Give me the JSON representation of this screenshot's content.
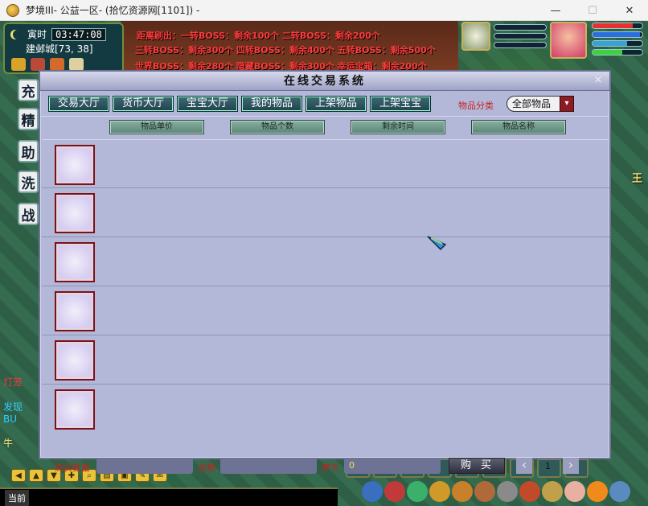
{
  "window": {
    "title": "梦境III- 公益一区- (拾忆资源网[1101]) -",
    "minimize": "—",
    "maximize": "☐",
    "close": "✕"
  },
  "hud": {
    "clock_label": "寅时",
    "time": "03:47:08",
    "location": "建邺城[73, 38]",
    "boss_lines": [
      "距离刷出：一转BOSS：剩余100个  二转BOSS：剩余200个",
      "三转BOSS：剩余300个  四转BOSS：剩余400个  五转BOSS：剩余500个",
      "世界BOSS：剩余280个  隐藏BOSS：剩余300个  幸运宝箱：剩余200个"
    ],
    "side_buttons": [
      "充",
      "精",
      "助",
      "洗",
      "战"
    ],
    "chat_left": [
      "灯笼",
      "发现BU",
      "牛"
    ],
    "chat_channel": "当前",
    "right_text": "王"
  },
  "bars": {
    "player_hp": 0.8,
    "player_mp": 0.95,
    "player_sp": 0.7,
    "player_exp": 0.6,
    "colors": {
      "hp": "#e83030",
      "mp": "#2a6ee0",
      "sp": "#3aa0d8",
      "exp": "#3fd040"
    }
  },
  "dialog": {
    "title": "在线交易系统",
    "close": "×",
    "tabs": [
      "交易大厅",
      "货币大厅",
      "宝宝大厅",
      "我的物品",
      "上架物品",
      "上架宝宝"
    ],
    "category_label": "物品分类",
    "category_value": "全部物品",
    "columns": [
      "物品单价",
      "物品个数",
      "剩余时间",
      "物品名称"
    ],
    "footer": {
      "qty_label": "购买数量",
      "qty_value": "",
      "total_label": "总额",
      "total_value": "",
      "currency_label": "梦币",
      "currency_value": "0",
      "buy_label": "购买",
      "prev": "‹",
      "page": "1",
      "next": "›"
    }
  },
  "toolbar_icons": [
    "arrow-left-icon",
    "arrow-up-icon",
    "arrow-down-icon",
    "move-icon",
    "search-icon",
    "document-icon",
    "lock-icon",
    "broom-icon",
    "chat-icon"
  ],
  "accent": {
    "frame": "#6d7196",
    "panel": "#b4b8d8",
    "label_red": "#c62020",
    "tab": "#1f434d"
  }
}
